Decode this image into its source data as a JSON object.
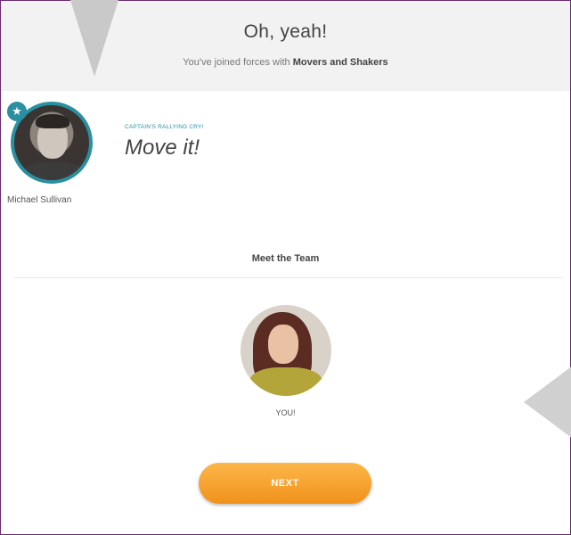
{
  "header": {
    "title": "Oh, yeah!",
    "subtitle_prefix": "You've joined forces with",
    "team_name": "Movers and Shakers"
  },
  "captain": {
    "name": "Michael Sullivan",
    "badge_icon": "star-icon",
    "rallying_cry_label": "CAPTAIN'S RALLYING CRY!",
    "rallying_cry": "Move it!"
  },
  "team": {
    "heading": "Meet the Team",
    "members": [
      {
        "label": "YOU!"
      }
    ]
  },
  "actions": {
    "next_label": "NEXT"
  },
  "colors": {
    "accent_teal": "#2a8f9f",
    "button_orange": "#f5a131",
    "header_band": "#f2f2f2"
  }
}
